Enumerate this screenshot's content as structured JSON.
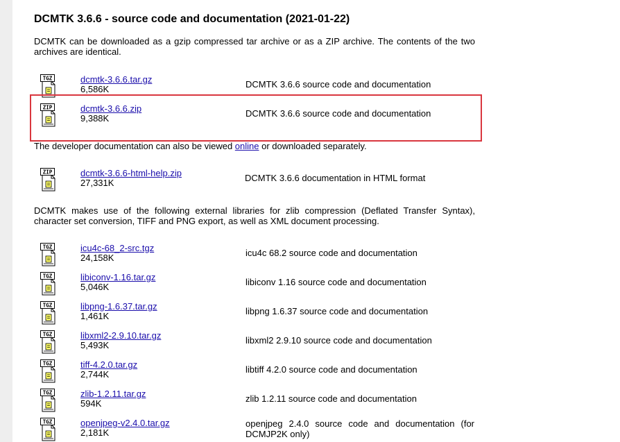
{
  "title": "DCMTK 3.6.6 - source code and documentation (2021-01-22)",
  "intro": "DCMTK can be downloaded as a gzip compressed tar archive or as a ZIP archive. The contents of the two archives are identical.",
  "archives": [
    {
      "icon": "tgz-file-icon",
      "icon_label": "TGZ",
      "name": "dcmtk-3.6.6.tar.gz",
      "size": "6,586K",
      "desc": "DCMTK 3.6.6 source code and documentation"
    },
    {
      "icon": "zip-file-icon",
      "icon_label": "ZIP",
      "name": "dcmtk-3.6.6.zip",
      "size": "9,388K",
      "desc": "DCMTK 3.6.6 source code and documentation"
    }
  ],
  "devdoc": {
    "before": "The developer documentation can also be viewed ",
    "link": "online",
    "after": " or downloaded separately."
  },
  "docs": [
    {
      "icon": "zip-file-icon",
      "icon_label": "ZIP",
      "name": "dcmtk-3.6.6-html-help.zip",
      "size": "27,331K",
      "desc": "DCMTK 3.6.6 documentation in HTML format"
    }
  ],
  "libs_intro": "DCMTK makes use of the following external libraries for zlib compression (Deflated Transfer Syntax), character set conversion, TIFF and PNG export, as well as XML document processing.",
  "libs": [
    {
      "icon": "tgz-file-icon",
      "icon_label": "TGZ",
      "name": "icu4c-68_2-src.tgz",
      "size": "24,158K",
      "desc": "icu4c 68.2 source code and documentation"
    },
    {
      "icon": "tgz-file-icon",
      "icon_label": "TGZ",
      "name": "libiconv-1.16.tar.gz",
      "size": "5,046K",
      "desc": "libiconv 1.16 source code and documentation"
    },
    {
      "icon": "tgz-file-icon",
      "icon_label": "TGZ",
      "name": "libpng-1.6.37.tar.gz",
      "size": "1,461K",
      "desc": "libpng 1.6.37 source code and documentation"
    },
    {
      "icon": "tgz-file-icon",
      "icon_label": "TGZ",
      "name": "libxml2-2.9.10.tar.gz",
      "size": "5,493K",
      "desc": "libxml2 2.9.10 source code and documentation"
    },
    {
      "icon": "tgz-file-icon",
      "icon_label": "TGZ",
      "name": "tiff-4.2.0.tar.gz",
      "size": "2,744K",
      "desc": "libtiff 4.2.0 source code and documentation"
    },
    {
      "icon": "tgz-file-icon",
      "icon_label": "TGZ",
      "name": "zlib-1.2.11.tar.gz",
      "size": "594K",
      "desc": "zlib 1.2.11 source code and documentation"
    },
    {
      "icon": "tgz-file-icon",
      "icon_label": "TGZ",
      "name": "openjpeg-v2.4.0.tar.gz",
      "size": "2,181K",
      "desc": "openjpeg 2.4.0 source code and documentation (for DCMJP2K only)"
    }
  ],
  "colors": {
    "link": "#1a0dab",
    "highlight": "#d9363e"
  }
}
